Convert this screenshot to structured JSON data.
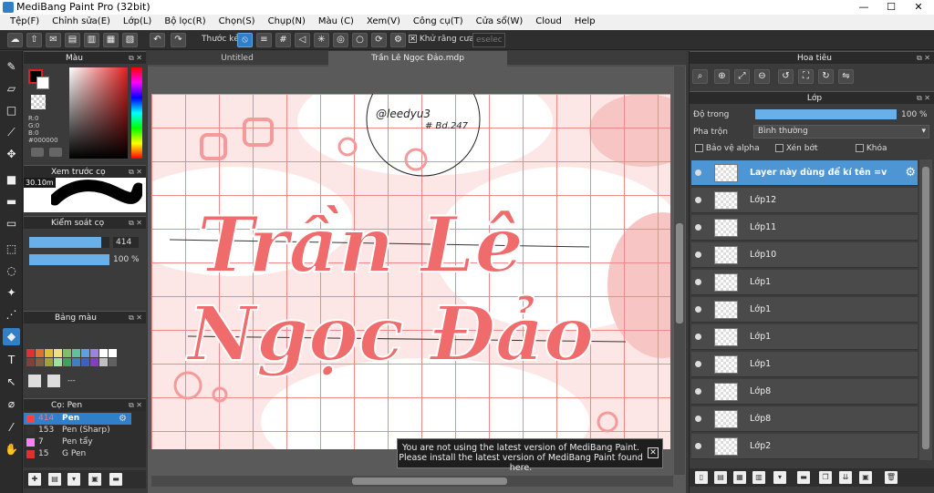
{
  "window": {
    "title": "MediBang Paint Pro (32bit)",
    "min": "—",
    "max": "☐",
    "close": "✕"
  },
  "menu": [
    "Tệp(F)",
    "Chỉnh sửa(E)",
    "Lớp(L)",
    "Bộ lọc(R)",
    "Chọn(S)",
    "Chụp(N)",
    "Màu (C)",
    "Xem(V)",
    "Công cụ(T)",
    "Cửa sổ(W)",
    "Cloud",
    "Help"
  ],
  "toolbar": {
    "ruler_label": "Thước kẻ",
    "antialias_label": "Khử răng cưa",
    "antialias_checked": "✕",
    "deselect": "eselec"
  },
  "colorPanel": {
    "title": "Màu",
    "r": "R:0",
    "g": "G:0",
    "b": "B:0",
    "hex": "#000000"
  },
  "brushPreview": {
    "title": "Xem trước cọ",
    "size": "30.10m"
  },
  "brushControl": {
    "title": "Kiểm soát cọ",
    "size_value": "414",
    "opacity_value": "100 %",
    "size_fill": 0.9,
    "opacity_fill": 1.0
  },
  "palette": {
    "title": "Bảng màu",
    "name": "---",
    "colors": [
      "#e03030",
      "#e07030",
      "#e0c030",
      "#f0e080",
      "#80c060",
      "#60c0a0",
      "#60a0e0",
      "#a080e0",
      "#ffffff",
      "#ffffff",
      "#804040",
      "#806040",
      "#a0a040",
      "#a0e0a0",
      "#40a060",
      "#4080c0",
      "#4060c0",
      "#8040c0",
      "#c0c0c0",
      "#606060"
    ]
  },
  "brushes": {
    "title": "Cọ: Pen",
    "items": [
      {
        "size": "414",
        "name": "Pen",
        "color": "#ff4040",
        "selected": true
      },
      {
        "size": "153",
        "name": "Pen (Sharp)",
        "color": "#333333",
        "selected": false
      },
      {
        "size": "7",
        "name": "Pen tẩy",
        "color": "#ff80ff",
        "selected": false
      },
      {
        "size": "15",
        "name": "G Pen",
        "color": "#e03030",
        "selected": false
      }
    ]
  },
  "tabs": [
    "Untitled",
    "Trần Lê Ngọc Đảo.mdp"
  ],
  "artwork": {
    "line1": "Trần Lê",
    "line2": "Ngọc Đảo",
    "watermark": "@leedyu3",
    "tag": "# Bd.247"
  },
  "notification": {
    "line1": "You are not using the latest version of MediBang Paint.",
    "line2": "Please install the latest version of MediBang Paint found here.",
    "close": "✕"
  },
  "navigator": {
    "title": "Hoa tiêu"
  },
  "layersPanel": {
    "title": "Lớp",
    "opacity_label": "Độ trong",
    "opacity_value": "100 %",
    "opacity_fill": 1.0,
    "blend_label": "Pha trộn",
    "blend_value": "Bình thường",
    "protect_alpha": "Bảo vệ alpha",
    "clip": "Xén bớt",
    "lock": "Khóa",
    "layers": [
      {
        "name": "Layer này dùng để kí tên =v",
        "selected": true
      },
      {
        "name": "Lớp12",
        "selected": false
      },
      {
        "name": "Lớp11",
        "selected": false
      },
      {
        "name": "Lớp10",
        "selected": false
      },
      {
        "name": "Lớp1",
        "selected": false
      },
      {
        "name": "Lớp1",
        "selected": false
      },
      {
        "name": "Lớp1",
        "selected": false
      },
      {
        "name": "Lớp1",
        "selected": false
      },
      {
        "name": "Lớp8",
        "selected": false
      },
      {
        "name": "Lớp8",
        "selected": false
      },
      {
        "name": "Lớp2",
        "selected": false
      }
    ]
  }
}
